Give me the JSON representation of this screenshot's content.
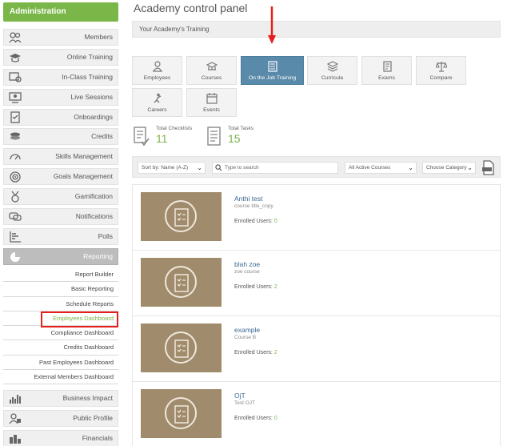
{
  "sidebar": {
    "admin_label": "Administration",
    "items": [
      {
        "label": "Members",
        "icon": "members-icon"
      },
      {
        "label": "Online Training",
        "icon": "graduation-cap-icon"
      },
      {
        "label": "In-Class Training",
        "icon": "classroom-icon"
      },
      {
        "label": "Live Sessions",
        "icon": "live-session-icon"
      },
      {
        "label": "Onboardings",
        "icon": "onboarding-icon"
      },
      {
        "label": "Credits",
        "icon": "coins-icon"
      },
      {
        "label": "Skills Management",
        "icon": "gauge-icon"
      },
      {
        "label": "Goals Management",
        "icon": "target-icon"
      },
      {
        "label": "Gamification",
        "icon": "medal-icon"
      },
      {
        "label": "Notifications",
        "icon": "chat-icon"
      },
      {
        "label": "Polls",
        "icon": "poll-icon"
      },
      {
        "label": "Reporting",
        "icon": "pie-chart-icon"
      }
    ],
    "reporting_sub": [
      "Report Builder",
      "Basic Reporting",
      "Schedule Reports",
      "Employees Dashboard",
      "Compliance Dashboard",
      "Credits Dashboard",
      "Past Employees Dashboard",
      "External Members Dashboard"
    ],
    "items_after": [
      {
        "label": "Business Impact",
        "icon": "bar-chart-icon"
      },
      {
        "label": "Public Profile",
        "icon": "profile-icon"
      },
      {
        "label": "Financials",
        "icon": "financials-icon"
      }
    ]
  },
  "main": {
    "title": "Academy control panel",
    "training_bar": "Your Academy's Training",
    "tiles": [
      {
        "label": "Employees",
        "icon": "person-icon"
      },
      {
        "label": "Courses",
        "icon": "courses-icon"
      },
      {
        "label": "On the Job Training",
        "icon": "checklist-icon"
      },
      {
        "label": "Curricula",
        "icon": "curricula-icon"
      },
      {
        "label": "Exams",
        "icon": "exams-icon"
      },
      {
        "label": "Compare",
        "icon": "scales-icon"
      },
      {
        "label": "Careers",
        "icon": "careers-icon"
      },
      {
        "label": "Events",
        "icon": "calendar-icon"
      }
    ],
    "stats": [
      {
        "label": "Total Checklists",
        "value": "11"
      },
      {
        "label": "Total Tasks",
        "value": "15"
      }
    ],
    "filters": {
      "sort": "Sort by: Name (A-Z)",
      "search_placeholder": "Type to search",
      "courses": "All Active Courses",
      "category": "Choose Category"
    },
    "enrolled_label": "Enrolled Users:",
    "courses": [
      {
        "name": "Anthi test",
        "code": "course title_copy",
        "enrolled": "0"
      },
      {
        "name": "blah zoe",
        "code": "zoe course",
        "enrolled": "2"
      },
      {
        "name": "example",
        "code": "Course B",
        "enrolled": "2"
      },
      {
        "name": "OjT",
        "code": "Test OJT",
        "enrolled": "0"
      }
    ]
  },
  "colors": {
    "accent": "#7ab648",
    "selected_tile": "#5a8aa9",
    "highlight": "#e8201c",
    "link": "#3c6a93"
  }
}
